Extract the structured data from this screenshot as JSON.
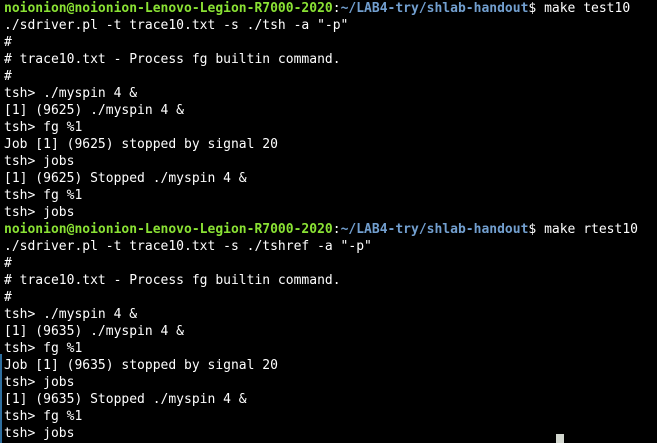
{
  "session1": {
    "prompt_user": "noionion@noionion-Lenovo-Legion-R7000-2020",
    "prompt_sep": ":",
    "prompt_path": "~/LAB4-try/shlab-handout",
    "prompt_dollar": "$ ",
    "command": "make test10",
    "output": [
      "./sdriver.pl -t trace10.txt -s ./tsh -a \"-p\"",
      "#",
      "# trace10.txt - Process fg builtin command.",
      "#",
      "tsh> ./myspin 4 &",
      "[1] (9625) ./myspin 4 &",
      "tsh> fg %1",
      "Job [1] (9625) stopped by signal 20",
      "tsh> jobs",
      "[1] (9625) Stopped ./myspin 4 &",
      "tsh> fg %1",
      "tsh> jobs"
    ]
  },
  "session2": {
    "prompt_user": "noionion@noionion-Lenovo-Legion-R7000-2020",
    "prompt_sep": ":",
    "prompt_path": "~/LAB4-try/shlab-handout",
    "prompt_dollar": "$ ",
    "command": "make rtest10",
    "output": [
      "./sdriver.pl -t trace10.txt -s ./tshref -a \"-p\"",
      "#",
      "# trace10.txt - Process fg builtin command.",
      "#",
      "tsh> ./myspin 4 &",
      "[1] (9635) ./myspin 4 &",
      "tsh> fg %1",
      "Job [1] (9635) stopped by signal 20",
      "tsh> jobs",
      "[1] (9635) Stopped ./myspin 4 &",
      "tsh> fg %1",
      "tsh> jobs"
    ]
  },
  "colors": {
    "background": "#000000",
    "text": "#ffffff",
    "prompt_user": "#8ae234",
    "prompt_path": "#729fcf"
  }
}
